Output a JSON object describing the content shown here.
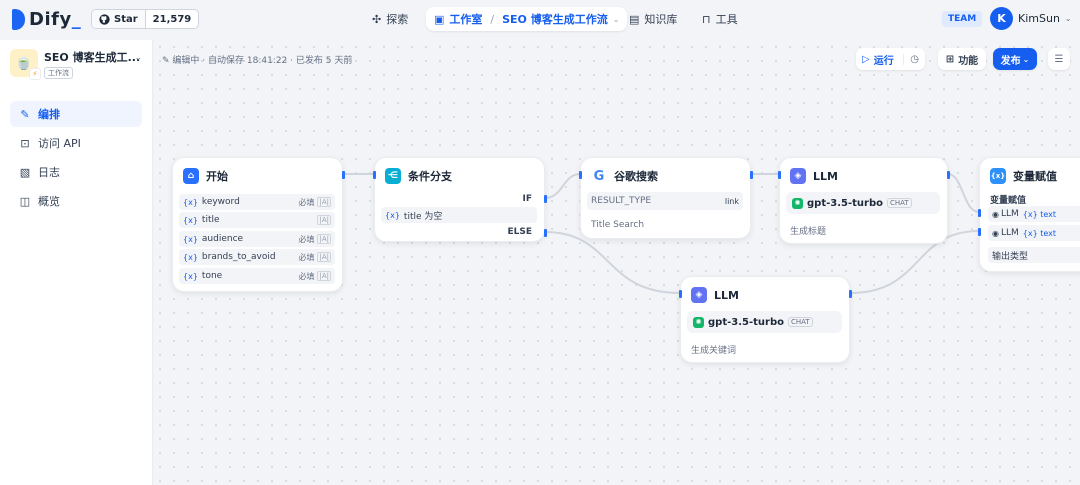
{
  "topbar": {
    "brand": {
      "name": "Dify",
      "suffix": "_"
    },
    "github": {
      "star_label": "Star",
      "count": "21,579"
    },
    "nav": {
      "explore": "探索",
      "studio": "工作室",
      "separator": "/",
      "current_app": "SEO 博客生成工作流",
      "knowledge": "知识库",
      "tools": "工具"
    },
    "team_badge": "TEAM",
    "user": {
      "initial": "K",
      "name": "KimSun"
    }
  },
  "sidebar": {
    "app_title": "SEO 博客生成工...",
    "app_type": "工作流",
    "app_icon": "teapot-emoji",
    "items": [
      {
        "label": "编排",
        "icon": "workflow-edit-icon",
        "active": true
      },
      {
        "label": "访问 API",
        "icon": "terminal-icon",
        "active": false
      },
      {
        "label": "日志",
        "icon": "log-icon",
        "active": false
      },
      {
        "label": "概览",
        "icon": "overview-icon",
        "active": false
      }
    ]
  },
  "canvas": {
    "status": "编辑中 · 自动保存 18:41:22 · 已发布 5 天前",
    "toolbar": {
      "run": "运行",
      "features": "功能",
      "publish": "发布"
    }
  },
  "nodes": {
    "start": {
      "title": "开始",
      "vars": [
        {
          "var_tag": "{x}",
          "name": "keyword",
          "required": "必填",
          "type": "|A|"
        },
        {
          "var_tag": "{x}",
          "name": "title",
          "required": "",
          "type": "|A|"
        },
        {
          "var_tag": "{x}",
          "name": "audience",
          "required": "必填",
          "type": "|A|"
        },
        {
          "var_tag": "{x}",
          "name": "brands_to_avoid",
          "required": "必填",
          "type": "|A|"
        },
        {
          "var_tag": "{x}",
          "name": "tone",
          "required": "必填",
          "type": "|A|"
        }
      ]
    },
    "ifelse": {
      "title": "条件分支",
      "if_label": "IF",
      "condition_var": "{x}",
      "condition": "title 为空",
      "else_label": "ELSE"
    },
    "google": {
      "title": "谷歌搜索",
      "param_key": "RESULT_TYPE",
      "param_val": "link",
      "desc": "Title Search"
    },
    "llm1": {
      "title": "LLM",
      "model": "gpt-3.5-turbo",
      "mode": "CHAT",
      "desc": "生成标题"
    },
    "llm2": {
      "title": "LLM",
      "model": "gpt-3.5-turbo",
      "mode": "CHAT",
      "desc": "生成关键词"
    },
    "assigner": {
      "title": "变量赋值",
      "section": "变量赋值",
      "rows": [
        {
          "node": "LLM",
          "var": "{x} text"
        },
        {
          "node": "LLM",
          "var": "{x} text"
        }
      ],
      "output_label": "输出类型"
    }
  },
  "colors": {
    "accent": "#155eef",
    "start_icon": "#2970ff",
    "ifelse_icon": "#06aed4",
    "llm_icon": "#6172f3",
    "assigner_icon": "#2e90fa",
    "edge": "#d0d5dd"
  }
}
